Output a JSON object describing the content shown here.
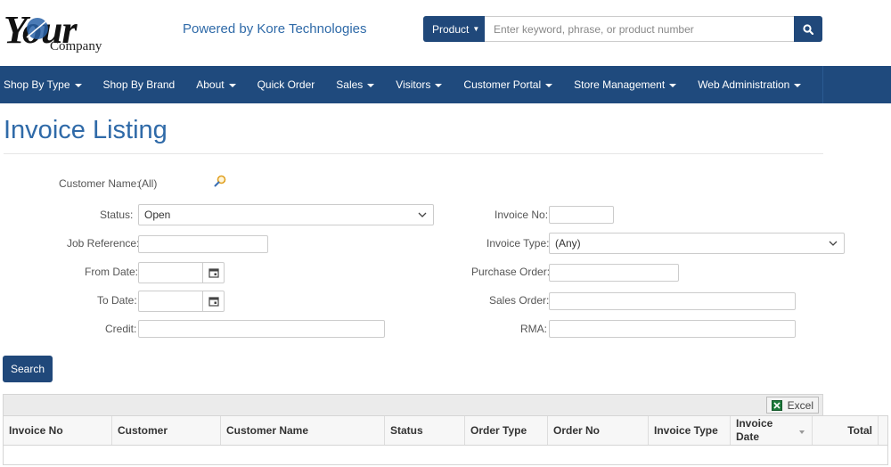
{
  "header": {
    "logo_text": "Your",
    "logo_sub": "Company",
    "powered_by": "Powered by Kore Technologies",
    "search": {
      "type_label": "Product",
      "placeholder": "Enter keyword, phrase, or product number"
    }
  },
  "nav": {
    "items": [
      {
        "label": "Shop By Type",
        "dropdown": true
      },
      {
        "label": "Shop By Brand",
        "dropdown": false
      },
      {
        "label": "About",
        "dropdown": true
      },
      {
        "label": "Quick Order",
        "dropdown": false
      },
      {
        "label": "Sales",
        "dropdown": true
      },
      {
        "label": "Visitors",
        "dropdown": true
      },
      {
        "label": "Customer Portal",
        "dropdown": true
      },
      {
        "label": "Store Management",
        "dropdown": true
      },
      {
        "label": "Web Administration",
        "dropdown": true
      }
    ]
  },
  "page": {
    "title": "Invoice Listing"
  },
  "form": {
    "customer_name_label": "Customer Name:",
    "customer_name_value": "(All)",
    "status_label": "Status:",
    "status_value": "Open",
    "job_reference_label": "Job Reference:",
    "from_date_label": "From Date:",
    "to_date_label": "To Date:",
    "credit_label": "Credit:",
    "invoice_no_label": "Invoice No:",
    "invoice_type_label": "Invoice Type:",
    "invoice_type_value": "(Any)",
    "purchase_order_label": "Purchase Order:",
    "sales_order_label": "Sales Order:",
    "rma_label": "RMA:",
    "search_button": "Search"
  },
  "grid": {
    "excel_label": "Excel",
    "columns": [
      "Invoice No",
      "Customer",
      "Customer Name",
      "Status",
      "Order Type",
      "Order No",
      "Invoice Type",
      "Invoice Date",
      "Total"
    ]
  },
  "colors": {
    "brand_blue": "#1f4a7d",
    "title_blue": "#2f6aa8"
  }
}
